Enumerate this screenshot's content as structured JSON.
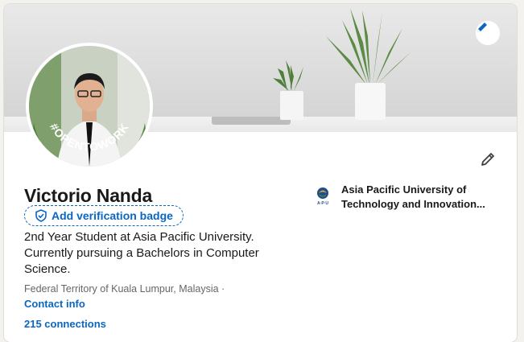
{
  "profile": {
    "name": "Victorio Nanda",
    "verification_label": "Add verification badge",
    "headline": "2nd Year Student at Asia Pacific University. Currently pursuing a Bachelors in Computer Science.",
    "location": "Federal Territory of Kuala Lumpur, Malaysia ·",
    "contact_label": "Contact info",
    "connections_label": "215 connections",
    "open_to_work_badge": "#OPENTOWORK"
  },
  "education": {
    "line1": "Asia Pacific University of",
    "line2": "Technology and Innovation..."
  },
  "logo_text": "A·P·U",
  "icons": {
    "banner_edit": "pencil-icon",
    "profile_edit": "pencil-icon",
    "verify": "shield-check-icon"
  },
  "colors": {
    "accent": "#0a66c2",
    "open_to_work": "#3f7f2e"
  }
}
